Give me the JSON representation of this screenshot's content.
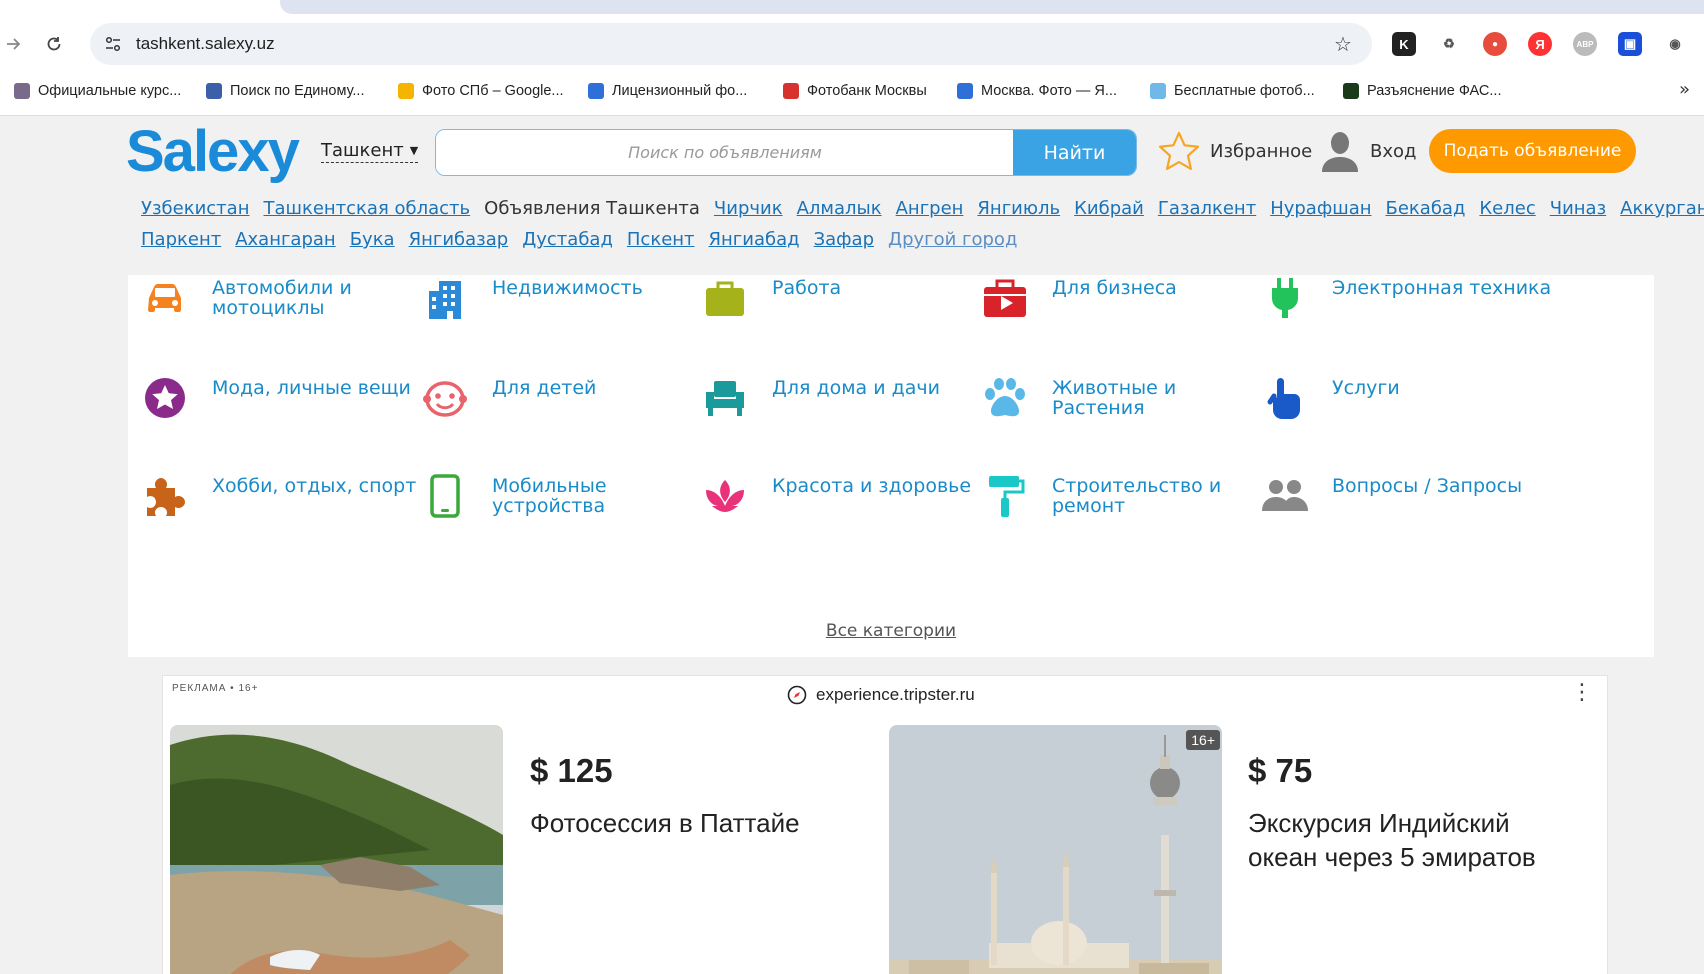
{
  "browser": {
    "url": "tashkent.salexy.uz",
    "bookmarks": [
      {
        "label": "Официальные курс...",
        "color": "#7a6a8a"
      },
      {
        "label": "Поиск по Единому...",
        "color": "#3b5fa8"
      },
      {
        "label": "Фото СПб – Google...",
        "color": "#f4b400"
      },
      {
        "label": "Лицензионный фо...",
        "color": "#2e6fd8"
      },
      {
        "label": "Фотобанк Москвы",
        "color": "#d8322e"
      },
      {
        "label": "Москва. Фото — Я...",
        "color": "#2e6fd8"
      },
      {
        "label": "Бесплатные фотоб...",
        "color": "#6fb8e8"
      },
      {
        "label": "Разъяснение ФАС...",
        "color": "#1a3a1a"
      }
    ],
    "extensions": [
      {
        "name": "k-extension-icon",
        "label": "K",
        "color": "#222222"
      },
      {
        "name": "recycle-extension-icon",
        "label": "♻",
        "color": "#ffffff"
      },
      {
        "name": "record-extension-icon",
        "label": "●",
        "color": "#e74c3c"
      },
      {
        "name": "yandex-extension-icon",
        "label": "Я",
        "color": "#f33"
      },
      {
        "name": "adblock-extension-icon",
        "label": "ABP",
        "color": "#aaaaaa"
      },
      {
        "name": "screenshot-extension-icon",
        "label": "▣",
        "color": "#1a4fd8"
      },
      {
        "name": "puzzle-extension-icon",
        "label": "◉",
        "color": "#ffffff"
      }
    ]
  },
  "header": {
    "logo": "Salexy",
    "city": "Ташкент",
    "search_placeholder": "Поиск по объявлениям",
    "search_button": "Найти",
    "favorites": "Избранное",
    "login": "Вход",
    "post_ad": "Подать объявление"
  },
  "regions": {
    "row1": [
      "Узбекистан",
      "Ташкентская область",
      "Объявления Ташкента",
      "Чирчик",
      "Алмалык",
      "Ангрен",
      "Янгиюль",
      "Кибрай",
      "Газалкент",
      "Нурафшан",
      "Бекабад",
      "Келес",
      "Чиназ",
      "Аккурган"
    ],
    "current": "Объявления Ташкента",
    "row2": [
      "Паркент",
      "Ахангаран",
      "Бука",
      "Янгибазар",
      "Дустабад",
      "Пскент",
      "Янгиабад",
      "Зафар"
    ],
    "other": "Другой город"
  },
  "categories": [
    {
      "name": "cat-auto",
      "label": "Автомобили и мотоциклы",
      "icon": "car-icon",
      "color": "#f5821f"
    },
    {
      "name": "cat-realty",
      "label": "Недвижимость",
      "icon": "building-icon",
      "color": "#2a8ad8"
    },
    {
      "name": "cat-jobs",
      "label": "Работа",
      "icon": "briefcase-icon",
      "color": "#a6b21a"
    },
    {
      "name": "cat-business",
      "label": "Для бизнеса",
      "icon": "business-case-icon",
      "color": "#d8232a"
    },
    {
      "name": "cat-electronics",
      "label": "Электронная техника",
      "icon": "plug-icon",
      "color": "#22c35a"
    },
    {
      "name": "cat-fashion",
      "label": "Мода, личные вещи",
      "icon": "star-badge-icon",
      "color": "#8a2a8a"
    },
    {
      "name": "cat-kids",
      "label": "Для детей",
      "icon": "baby-face-icon",
      "color": "#e8636b"
    },
    {
      "name": "cat-home",
      "label": "Для дома и дачи",
      "icon": "armchair-icon",
      "color": "#1a9a9a"
    },
    {
      "name": "cat-animals",
      "label": "Животные и Растения",
      "icon": "paw-icon",
      "color": "#5ab8e8"
    },
    {
      "name": "cat-services",
      "label": "Услуги",
      "icon": "pointer-hand-icon",
      "color": "#1a5ac8"
    },
    {
      "name": "cat-hobby",
      "label": "Хобби, отдых, спорт",
      "icon": "puzzle-icon",
      "color": "#c8641a"
    },
    {
      "name": "cat-mobile",
      "label": "Мобильные устройства",
      "icon": "smartphone-icon",
      "color": "#3aa83a"
    },
    {
      "name": "cat-beauty",
      "label": "Красота и здоровье",
      "icon": "lotus-icon",
      "color": "#e8337a"
    },
    {
      "name": "cat-construction",
      "label": "Строительство и ремонт",
      "icon": "paint-roller-icon",
      "color": "#1ac8c8"
    },
    {
      "name": "cat-questions",
      "label": "Вопросы / Запросы",
      "icon": "people-icon",
      "color": "#888888"
    }
  ],
  "all_categories": "Все категории",
  "ad": {
    "label": "РЕКЛАМА • 16+",
    "domain": "experience.tripster.ru",
    "cards": [
      {
        "price": "$ 125",
        "title": "Фотосессия в Паттайе",
        "badge": ""
      },
      {
        "price": "$ 75",
        "title": "Экскурсия Индийский океан через 5 эмиратов",
        "badge": "16+"
      }
    ]
  }
}
